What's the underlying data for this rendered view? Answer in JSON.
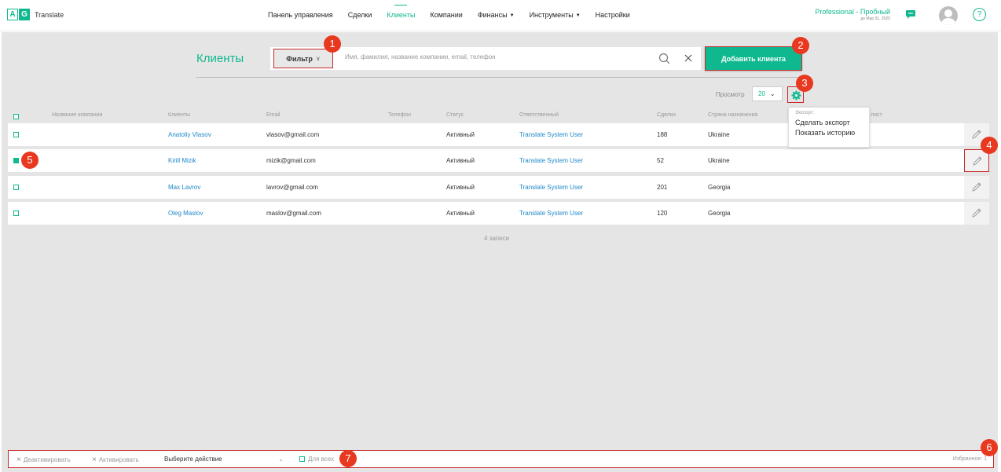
{
  "colors": {
    "accent": "#10b890",
    "link": "#1e88c8",
    "annotation": "#e8381f",
    "highlight_border": "#c62828"
  },
  "logo": {
    "letter1": "A",
    "letter2": "G",
    "name": "Translate"
  },
  "nav": [
    {
      "label": "Панель управления",
      "active": false,
      "dropdown": false
    },
    {
      "label": "Сделки",
      "active": false,
      "dropdown": false
    },
    {
      "label": "Клиенты",
      "active": true,
      "dropdown": false
    },
    {
      "label": "Компании",
      "active": false,
      "dropdown": false
    },
    {
      "label": "Финансы",
      "active": false,
      "dropdown": true
    },
    {
      "label": "Инструменты",
      "active": false,
      "dropdown": true
    },
    {
      "label": "Настройки",
      "active": false,
      "dropdown": false
    }
  ],
  "plan": {
    "name": "Professional - Пробный",
    "until": "до Мар 31, 2025"
  },
  "icons": {
    "chat": "chat-bubble-icon",
    "avatar": "user-avatar",
    "help": "question-mark-icon",
    "search": "search-icon",
    "clear": "close-icon",
    "settings": "gear-icon",
    "edit": "pencil-icon"
  },
  "help_glyph": "?",
  "page": {
    "title": "Клиенты",
    "filter_label": "Фильтр",
    "search_placeholder": "Имя, фамилия, название компании, email, телефон",
    "add_button": "Добавить клиента"
  },
  "view": {
    "label": "Просмотр",
    "value": "20"
  },
  "export_menu": {
    "title": "Экспорт:",
    "items": [
      "Сделать экспорт",
      "Показать историю"
    ]
  },
  "table": {
    "headers": [
      "Название компании",
      "Клиенты",
      "Email",
      "Телефон",
      "Статус",
      "Ответственный",
      "Сделки",
      "Страна назначения",
      "лист"
    ],
    "rows": [
      {
        "company": "",
        "client": "Anatoliy Vlasov",
        "email": "vlasov@gmail.com",
        "phone": "",
        "status": "Активный",
        "manager": "Translate System User",
        "deals": "188",
        "country": "Ukraine",
        "checked": false
      },
      {
        "company": "",
        "client": "Kirill Mizik",
        "email": "mizik@gmail.com",
        "phone": "",
        "status": "Активный",
        "manager": "Translate System User",
        "deals": "52",
        "country": "Ukraine",
        "checked": true
      },
      {
        "company": "",
        "client": "Max Lavrov",
        "email": "lavrov@gmail.com",
        "phone": "",
        "status": "Активный",
        "manager": "Translate System User",
        "deals": "201",
        "country": "Georgia",
        "checked": false
      },
      {
        "company": "",
        "client": "Oleg Maslov",
        "email": "maslov@gmail.com",
        "phone": "",
        "status": "Активный",
        "manager": "Translate System User",
        "deals": "120",
        "country": "Georgia",
        "checked": false
      }
    ],
    "records": "4 записи"
  },
  "bottom_bar": {
    "deactivate": "Деактивировать",
    "activate": "Активировать",
    "action_placeholder": "Выберите действие",
    "for_all": "Для всех",
    "favorites": "Избранное: 1"
  },
  "annotations": [
    "1",
    "2",
    "3",
    "4",
    "5",
    "6",
    "7"
  ]
}
